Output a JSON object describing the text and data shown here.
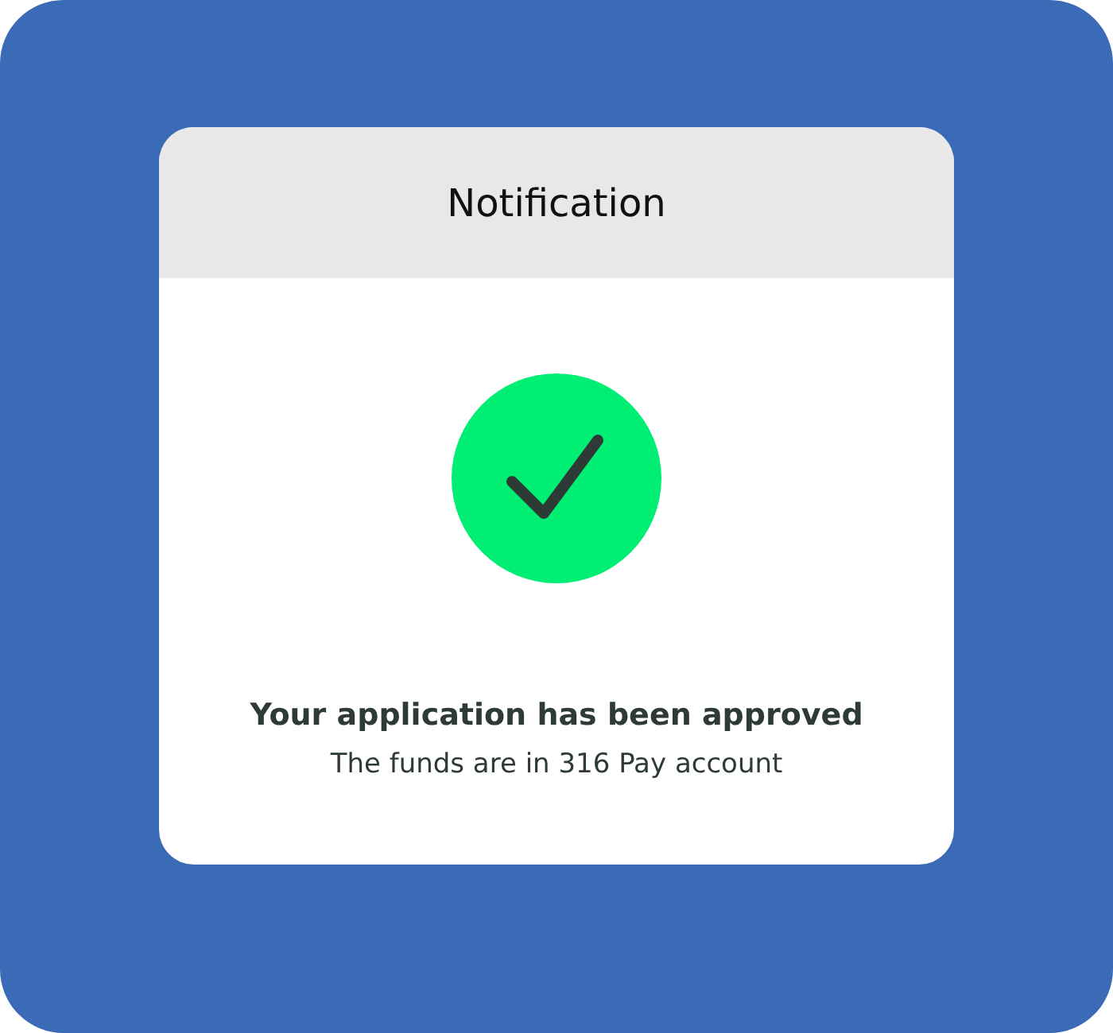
{
  "dialog": {
    "title": "Notification",
    "approved": true,
    "message": "Your application has been approved",
    "detail": "The funds are in 316 Pay account"
  }
}
